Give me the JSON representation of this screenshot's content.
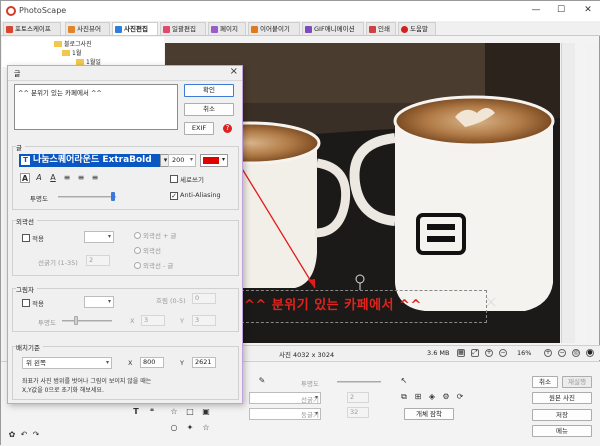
{
  "app": {
    "title": "PhotoScape",
    "window_controls": {
      "minimize": "—",
      "maximize": "☐",
      "close": "✕"
    }
  },
  "tabs": [
    {
      "label": "포토스케이프",
      "icon_color": "#d9462e"
    },
    {
      "label": "사진뷰어",
      "icon_color": "#e0862a"
    },
    {
      "label": "사진편집",
      "icon_color": "#2e7fd9",
      "active": true
    },
    {
      "label": "일괄편집",
      "icon_color": "#e04a6a"
    },
    {
      "label": "페이지",
      "icon_color": "#9a5cc9"
    },
    {
      "label": "이어붙이기",
      "icon_color": "#e07a1e"
    },
    {
      "label": "GIF애니메이션",
      "icon_color": "#7a4cc0"
    },
    {
      "label": "인쇄",
      "icon_color": "#d04040"
    },
    {
      "label": "도움말",
      "icon_color": "#d22020"
    }
  ],
  "tree": {
    "items": [
      "블로그사진",
      "1월",
      "1월일"
    ]
  },
  "caption_overlay": {
    "text": "^^ 분위기 있는 카페에서 ^^",
    "color": "#e0241d"
  },
  "statusbar": {
    "photo_size": "사진 4032 x 3024",
    "file_size": "3.6 MB",
    "zoom": "16%"
  },
  "dialog": {
    "title": "글",
    "text_value": "^^ 분위기 있는 카페에서 ^^",
    "buttons": {
      "ok": "확인",
      "cancel": "취소",
      "exif": "EXIF"
    },
    "font_group_title": "글",
    "font_name": "나눔스퀘어라운드 ExtraBold",
    "font_size": "200",
    "font_color": "#e00000",
    "vertical_label": "세로쓰기",
    "vertical_checked": false,
    "antialias_label": "Anti-Aliasing",
    "antialias_checked": true,
    "opacity_label": "투명도",
    "outline": {
      "group_title": "외곽선",
      "apply_label": "적용",
      "radio_1": "외곽선 + 글",
      "radio_2": "외곽선",
      "radio_3": "외곽선 - 글",
      "thickness_label": "선굵기 (1-35)",
      "thickness_value": "2"
    },
    "shadow": {
      "group_title": "그림자",
      "apply_label": "적용",
      "blur_label": "흐림 (0-5)",
      "blur_value": "0",
      "opacity_label": "투명도",
      "x_label": "X",
      "x_value": "3",
      "y_label": "Y",
      "y_value": "3"
    },
    "position": {
      "group_title": "배치기준",
      "anchor": "위 왼쪽",
      "x_label": "X",
      "x_value": "800",
      "y_label": "Y",
      "y_value": "2621",
      "note": "좌표가 사진 범위를 벗어나 그림이 보이지 않을 때는\nX,Y값을 0으로 초기화 해보세요."
    }
  },
  "bottom_panel": {
    "cancel": "취소",
    "save_btn_disabled": "재실행",
    "original": "원본 사진",
    "save": "저장",
    "menu": "메뉴",
    "opacity_label": "투명도",
    "thickness_label": "선굵기",
    "thickness_value": "2",
    "outline_label": "둥글기",
    "outline_value": "32",
    "objects_btn": "개체 잠착"
  }
}
